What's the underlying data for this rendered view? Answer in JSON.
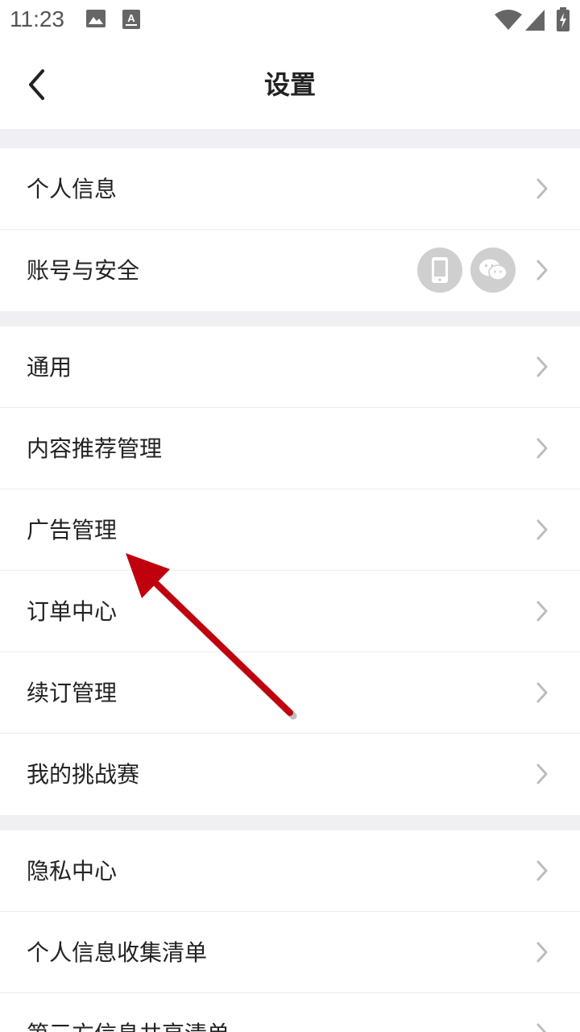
{
  "status_bar": {
    "time": "11:23",
    "icons": [
      "image-icon",
      "font-a-icon",
      "wifi-icon",
      "signal-icon",
      "battery-charging-icon"
    ]
  },
  "header": {
    "title": "设置",
    "back_icon": "chevron-left-icon"
  },
  "sections": [
    {
      "items": [
        {
          "label": "个人信息"
        },
        {
          "label": "账号与安全",
          "badges": [
            "phone-icon",
            "wechat-icon"
          ]
        }
      ]
    },
    {
      "items": [
        {
          "label": "通用"
        },
        {
          "label": "内容推荐管理"
        },
        {
          "label": "广告管理"
        },
        {
          "label": "订单中心"
        },
        {
          "label": "续订管理"
        },
        {
          "label": "我的挑战赛"
        }
      ]
    },
    {
      "items": [
        {
          "label": "隐私中心"
        },
        {
          "label": "个人信息收集清单"
        },
        {
          "label": "第三方信息共享清单"
        }
      ]
    }
  ],
  "colors": {
    "separator_bg": "#efeff4",
    "chevron": "#bdbdbd",
    "badge_bg": "#cfcfcf",
    "annotation_arrow": "#c0000d"
  },
  "annotation": {
    "type": "arrow",
    "target": "广告管理"
  }
}
